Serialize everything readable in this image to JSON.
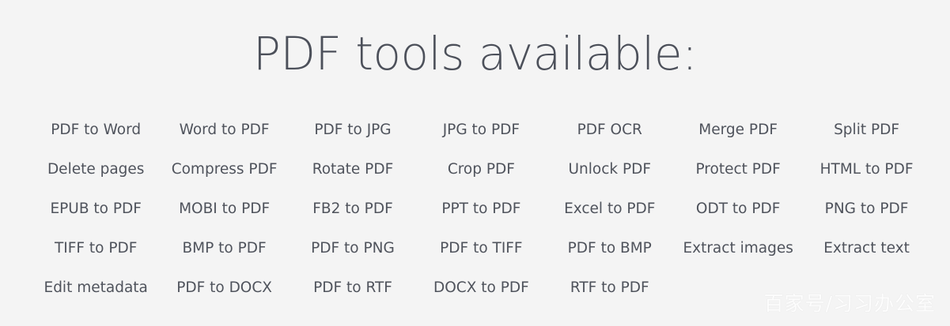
{
  "title": "PDF tools available:",
  "tools": [
    "PDF to Word",
    "Word to PDF",
    "PDF to JPG",
    "JPG to PDF",
    "PDF OCR",
    "Merge PDF",
    "Split PDF",
    "Delete pages",
    "Compress PDF",
    "Rotate PDF",
    "Crop PDF",
    "Unlock PDF",
    "Protect PDF",
    "HTML to PDF",
    "EPUB to PDF",
    "MOBI to PDF",
    "FB2 to PDF",
    "PPT to PDF",
    "Excel to PDF",
    "ODT to PDF",
    "PNG to PDF",
    "TIFF to PDF",
    "BMP to PDF",
    "PDF to PNG",
    "PDF to TIFF",
    "PDF to BMP",
    "Extract images",
    "Extract text",
    "Edit metadata",
    "PDF to DOCX",
    "PDF to RTF",
    "DOCX to PDF",
    "RTF to PDF"
  ],
  "watermark": "百家号/习习办公室",
  "colors": {
    "background": "#f4f4f4",
    "text": "#4f535c",
    "title": "#4c505a"
  }
}
